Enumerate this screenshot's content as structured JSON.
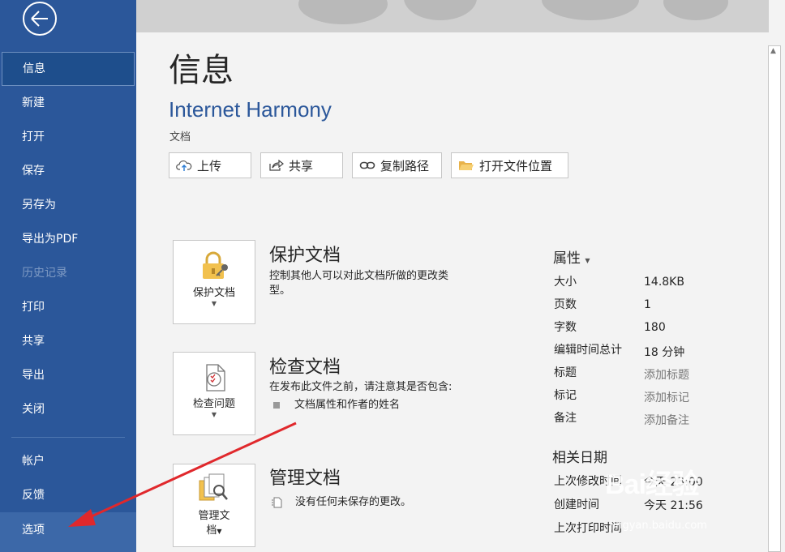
{
  "sidebar": {
    "items": [
      {
        "label": "信息"
      },
      {
        "label": "新建"
      },
      {
        "label": "打开"
      },
      {
        "label": "保存"
      },
      {
        "label": "另存为"
      },
      {
        "label": "导出为PDF"
      },
      {
        "label": "历史记录"
      },
      {
        "label": "打印"
      },
      {
        "label": "共享"
      },
      {
        "label": "导出"
      },
      {
        "label": "关闭"
      },
      {
        "label": "帐户"
      },
      {
        "label": "反馈"
      },
      {
        "label": "选项"
      }
    ]
  },
  "main": {
    "title": "信息",
    "doc_name": "Internet Harmony",
    "doc_location": "文档",
    "actions": {
      "upload": "上传",
      "share": "共享",
      "copy_path": "复制路径",
      "open_location": "打开文件位置"
    },
    "protect": {
      "button": "保护文档",
      "title": "保护文档",
      "desc_line1": "控制其他人可以对此文档所做的更改类",
      "desc_line2": "型。"
    },
    "inspect": {
      "button": "检查问题",
      "title": "检查文档",
      "desc": "在发布此文件之前，请注意其是否包含:",
      "bullet": "文档属性和作者的姓名"
    },
    "manage": {
      "button_line1": "管理文",
      "button_line2": "档",
      "title": "管理文档",
      "desc": "没有任何未保存的更改。"
    }
  },
  "properties": {
    "heading": "属性",
    "rows": [
      {
        "key": "大小",
        "value": "14.8KB"
      },
      {
        "key": "页数",
        "value": "1"
      },
      {
        "key": "字数",
        "value": "180"
      },
      {
        "key": "编辑时间总计",
        "value": "18 分钟"
      },
      {
        "key": "标题",
        "value": "添加标题"
      },
      {
        "key": "标记",
        "value": "添加标记"
      },
      {
        "key": "备注",
        "value": "添加备注"
      }
    ]
  },
  "dates": {
    "heading": "相关日期",
    "rows": [
      {
        "key": "上次修改时间",
        "value": "今天 23:00"
      },
      {
        "key": "创建时间",
        "value": "今天 21:56"
      },
      {
        "key": "上次打印时间",
        "value": ""
      }
    ]
  },
  "watermark": {
    "text": "Bai经验",
    "url": "jingyan.baidu.com"
  },
  "colors": {
    "sidebar": "#2b579a",
    "accent": "#2b579a",
    "annotation_arrow": "#e0282c"
  }
}
